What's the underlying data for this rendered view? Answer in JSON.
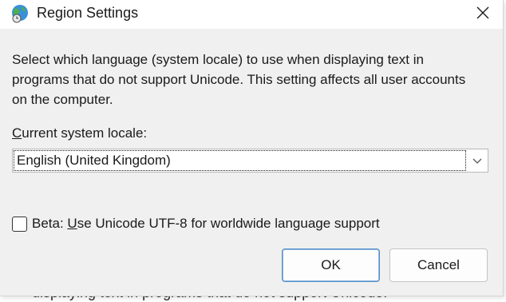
{
  "background": {
    "partial_text": "displaying text in programs that do not support Unicode."
  },
  "dialog": {
    "title": "Region Settings",
    "title_icon": "globe-clock-icon",
    "close_icon": "close-icon",
    "description": "Select which language (system locale) to use when displaying text in programs that do not support Unicode. This setting affects all user accounts on the computer.",
    "locale_label_accel": "C",
    "locale_label_rest": "urrent system locale:",
    "locale_value": "English (United Kingdom)",
    "beta_prefix": "Beta: ",
    "beta_accel": "U",
    "beta_rest": "se Unicode UTF-8 for worldwide language support",
    "beta_checked": false,
    "ok_label": "OK",
    "cancel_label": "Cancel"
  },
  "colors": {
    "content_bg": "#f0f0f0",
    "title_bg": "#ffffff",
    "ok_border": "#5a8fc9"
  }
}
